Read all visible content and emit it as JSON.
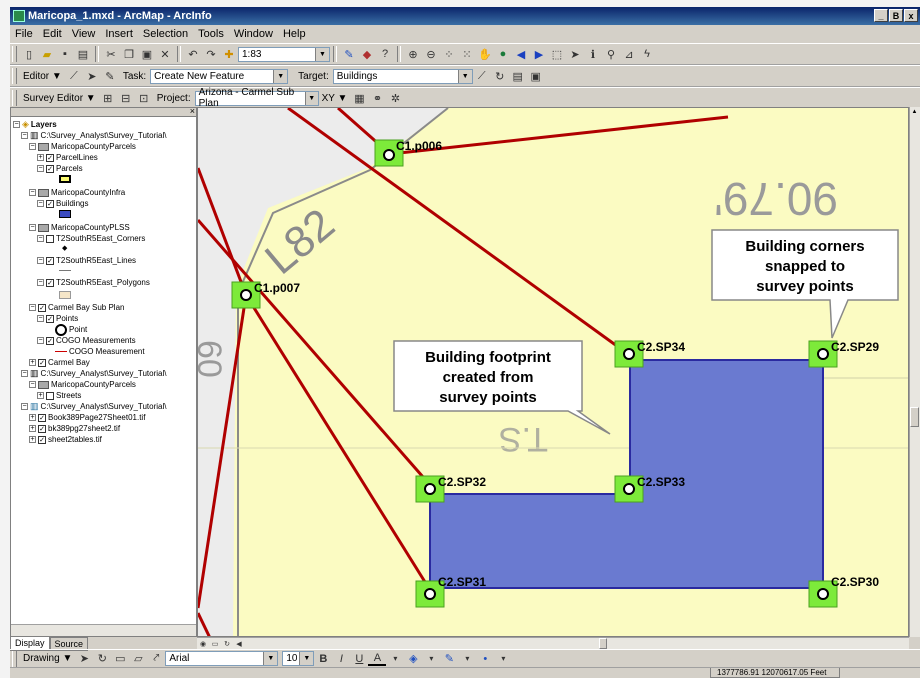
{
  "window": {
    "title": "Maricopa_1.mxd - ArcMap - ArcInfo",
    "controls": [
      "_",
      "B",
      "x"
    ]
  },
  "menu": [
    "File",
    "Edit",
    "View",
    "Insert",
    "Selection",
    "Tools",
    "Window",
    "Help"
  ],
  "standard_toolbar": {
    "scale": "1:83"
  },
  "editor_toolbar": {
    "editor_label": "Editor ▼",
    "task_label": "Task:",
    "task_value": "Create New Feature",
    "target_label": "Target:",
    "target_value": "Buildings"
  },
  "survey_toolbar": {
    "survey_editor_label": "Survey Editor ▼",
    "project_label": "Project:",
    "project_value": "Arizona - Carmel Sub Plan",
    "xy_label": "XY ▼"
  },
  "toc": {
    "root": "Layers",
    "items": [
      "C:\\Survey_Analyst\\Survey_Tutorial\\",
      "MaricopaCountyParcels",
      "ParcelLines",
      "Parcels",
      "MaricopaCountyInfra",
      "Buildings",
      "MaricopaCountyPLSS",
      "T2SouthR5East_Corners",
      "T2SouthR5East_Lines",
      "T2SouthR5East_Polygons",
      "Carmel Bay Sub Plan",
      "Points",
      "Point",
      "COGO Measurements",
      "COGO Measurement",
      "Carmel Bay",
      "C:\\Survey_Analyst\\Survey_Tutorial\\",
      "MaricopaCountyParcels",
      "Streets",
      "C:\\Survey_Analyst\\Survey_Tutorial\\",
      "Book389Page27Sheet01.tif",
      "bk389pg27sheet2.tif",
      "sheet2tables.tif"
    ],
    "tabs": [
      "Display",
      "Source"
    ]
  },
  "map": {
    "points": [
      "C1.p006",
      "C1.p007",
      "C2.SP34",
      "C2.SP29",
      "C2.SP32",
      "C2.SP33",
      "C2.SP31",
      "C2.SP30"
    ],
    "annotations": {
      "corners": [
        "Building corners",
        "snapped to",
        "survey points"
      ],
      "footprint": [
        "Building footprint",
        "created from",
        "survey points"
      ]
    },
    "background_text": {
      "parcel": "90.79'",
      "road": "L82",
      "side": "T.S",
      "lower": "60"
    },
    "colors": {
      "parcel": "#fbfbc2",
      "building": "#6a7ad0",
      "building_edge": "#2a2aa0",
      "point_box": "#7dea3a",
      "cogo_line": "#b00000"
    }
  },
  "draw_toolbar": {
    "drawing_label": "Drawing ▼",
    "font": "Arial",
    "size": "10",
    "bold": "B",
    "italic": "I",
    "underline": "U",
    "font_color": "A"
  },
  "status": {
    "coords": "1377786.91  12070617.05 Feet"
  }
}
